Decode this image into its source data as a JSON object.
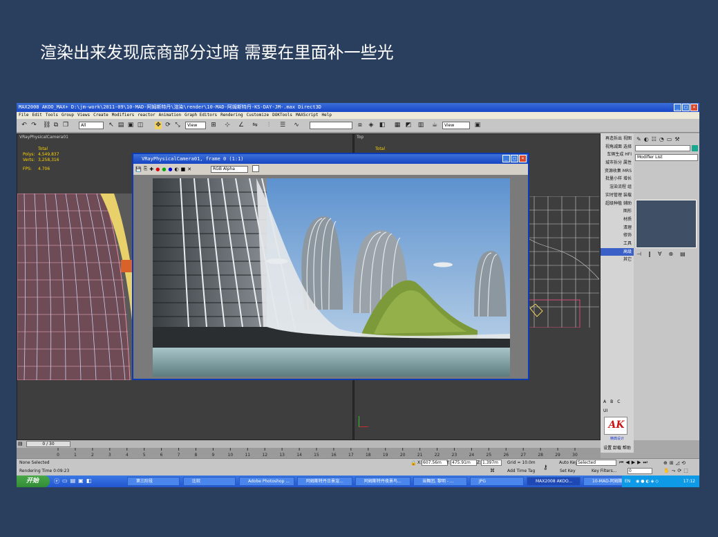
{
  "slide": {
    "title": "渲染出来发现底商部分过暗 需要在里面补一些光"
  },
  "app": {
    "title": "MAX2008   AKOO_MAX+     D:\\jm-work\\2011-09\\10-MAD-阿姆斯特丹\\渲染\\render\\10-MAD-阿姆斯特丹-KS-DAY-JM-.max     Direct3D",
    "menu": [
      "File",
      "Edit",
      "Tools",
      "Group",
      "Views",
      "Create",
      "Modifiers",
      "reactor",
      "Animation",
      "Graph Editors",
      "Rendering",
      "Customize",
      "DOKTools",
      "MAXScript",
      "Help"
    ],
    "toolbar": {
      "selection_filter": "All",
      "ref_coord": "View",
      "view_dropdown": "View"
    }
  },
  "viewports": {
    "left": {
      "label": "VRayPhysicalCamera01",
      "stats": {
        "total": "Total",
        "polys_label": "Polys:",
        "polys": "4,549,837",
        "verts_label": "Verts:",
        "verts": "3,258,316",
        "fps_label": "FPS:",
        "fps": "4.706"
      }
    },
    "right": {
      "label": "Top",
      "total": "Total"
    }
  },
  "vfb": {
    "title": "VRayPhysicalCamera01, frame 0 (1:1)",
    "channel": "RGB Alpha"
  },
  "cn_panel": {
    "items": [
      "再造拆出",
      "视图",
      "视角减面",
      "选择",
      "车辆生成",
      "HFI",
      "城市拆分",
      "属性",
      "资源收集",
      "MRS",
      "批量小样",
      "增长",
      "渲染流程",
      "组",
      "实时管理",
      "装载",
      "超级种植",
      "辅助",
      "图形",
      "材质",
      "清理",
      "修饰",
      "工具",
      "高级",
      "其它"
    ],
    "selected": "高级",
    "abc": [
      "A",
      "B",
      "C"
    ],
    "ui": "UI",
    "brand": "精典设计",
    "bottom": "设置 卸载 帮助"
  },
  "cmd_panel": {
    "modifier_list": "Modifier List"
  },
  "timeline": {
    "frame": "0 / 30",
    "ticks": [
      0,
      1,
      2,
      3,
      4,
      5,
      6,
      7,
      8,
      9,
      10,
      11,
      12,
      13,
      14,
      15,
      16,
      17,
      18,
      19,
      20,
      21,
      22,
      23,
      24,
      25,
      26,
      27,
      28,
      29,
      30
    ]
  },
  "status": {
    "selection": "None Selected",
    "time": "Rendering Time  0:09:23",
    "x_label": "X:",
    "x": "607.56m",
    "y_label": "Y:",
    "y": "475.91m",
    "z_label": "Z:",
    "z": "1.397m",
    "grid": "Grid = 10.0m",
    "add_time_tag": "Add Time Tag",
    "auto_key": "Auto Key",
    "set_key": "Set Key",
    "selected_dropdown": "Selected",
    "key_filters": "Key Filters...",
    "frame_field": "0"
  },
  "taskbar": {
    "start": "开始",
    "tasks": [
      "第三阶段",
      "比较",
      "Adobe Photoshop ...",
      "阿姆斯特丹日景渲...",
      "阿姆斯特丹夜景鸟...",
      "当舞团, 黎明 - ...",
      "JPG",
      "MAX2008   AKOO...",
      "10-MAD-阿姆斯特..."
    ],
    "lang": "EN",
    "clock": "17:12"
  }
}
